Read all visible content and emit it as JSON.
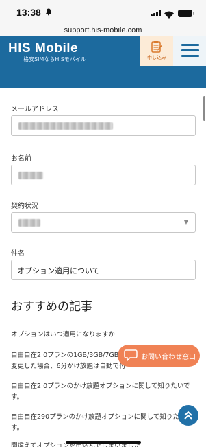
{
  "status_bar": {
    "time": "13:38",
    "bell_icon": "bell-muted-icon"
  },
  "browser": {
    "url": "support.his-mobile.com"
  },
  "header": {
    "logo_text": "HIS Mobile",
    "logo_tagline": "格安SIMならHISモバイル",
    "apply_label": "申し込み",
    "brand_color": "#1c6a9e"
  },
  "form": {
    "email": {
      "label": "メールアドレス"
    },
    "name": {
      "label": "お名前"
    },
    "contract_status": {
      "label": "契約状況"
    },
    "subject": {
      "label": "件名",
      "value": "オプション適用について"
    }
  },
  "recommended": {
    "heading": "おすすめの記事",
    "articles": [
      "オプションはいつ適用になりますか",
      "自由自在2.0プランの1GB/3GB/7GB",
      "変更した場合、6分かけ放題は自動で付",
      "自由自在2.0プランのかけ放題オプションに関して知りたいで",
      "す。",
      "自由自在290プランのかけ放題オプションに関して知りたい",
      "す。",
      "間違えてオプションを申込んでしまいました"
    ]
  },
  "contact_button": {
    "label": "お問い合わせ窓口",
    "color": "#f08255"
  },
  "to_top_button": {
    "icon": "double-chevron-up-icon"
  }
}
